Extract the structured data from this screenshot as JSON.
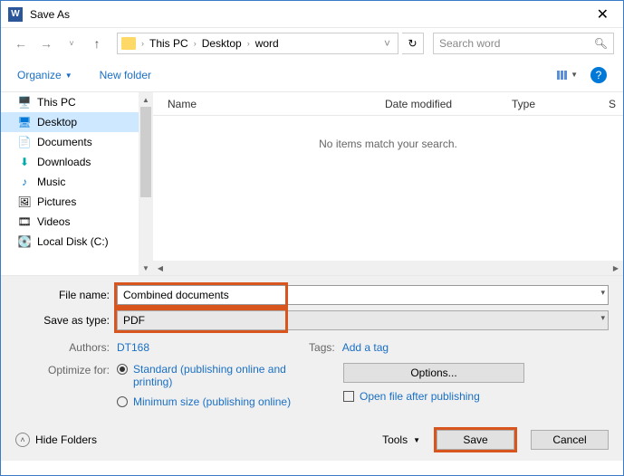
{
  "titlebar": {
    "title": "Save As",
    "word_letter": "W"
  },
  "nav": {
    "back": "←",
    "forward": "→",
    "recent": "˅",
    "up": "↑",
    "breadcrumb": [
      "This PC",
      "Desktop",
      "word"
    ],
    "refresh": "↻",
    "search_placeholder": "Search word"
  },
  "toolbar": {
    "organize": "Organize",
    "new_folder": "New folder"
  },
  "sidebar": {
    "items": [
      {
        "label": "This PC",
        "ico": "pc"
      },
      {
        "label": "Desktop",
        "ico": "desktop",
        "selected": true
      },
      {
        "label": "Documents",
        "ico": "doc"
      },
      {
        "label": "Downloads",
        "ico": "down"
      },
      {
        "label": "Music",
        "ico": "music"
      },
      {
        "label": "Pictures",
        "ico": "pic"
      },
      {
        "label": "Videos",
        "ico": "vid"
      },
      {
        "label": "Local Disk (C:)",
        "ico": "disk"
      }
    ]
  },
  "filelist": {
    "columns": {
      "name": "Name",
      "date": "Date modified",
      "type": "Type",
      "size_letter": "S"
    },
    "empty_msg": "No items match your search."
  },
  "form": {
    "filename_label": "File name:",
    "filename_value": "Combined documents",
    "savetype_label": "Save as type:",
    "savetype_value": "PDF",
    "authors_label": "Authors:",
    "authors_value": "DT168",
    "tags_label": "Tags:",
    "tags_value": "Add a tag",
    "optimize_label": "Optimize for:",
    "opt_standard": "Standard (publishing online and printing)",
    "opt_min": "Minimum size (publishing online)",
    "options_btn": "Options...",
    "open_after": "Open file after publishing"
  },
  "footer": {
    "hide_folders": "Hide Folders",
    "tools": "Tools",
    "save": "Save",
    "cancel": "Cancel"
  }
}
